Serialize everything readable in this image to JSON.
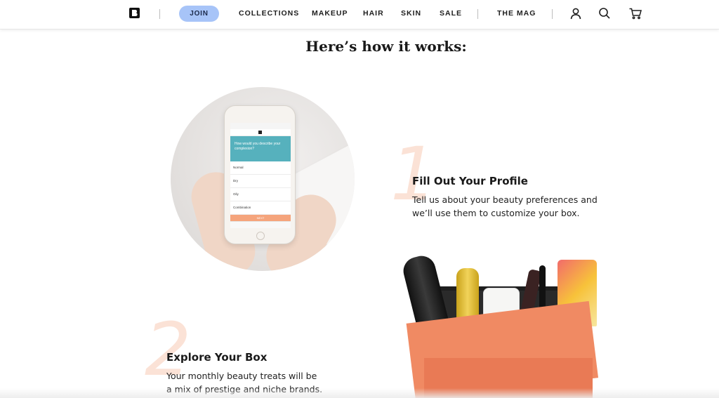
{
  "nav": {
    "join_label": "JOIN",
    "links": [
      "COLLECTIONS",
      "MAKEUP",
      "HAIR",
      "SKIN",
      "SALE",
      "THE MAG"
    ],
    "icons": [
      "account-icon",
      "search-icon",
      "cart-icon"
    ],
    "join_color": "#a7c4f8"
  },
  "main": {
    "headline": "Here’s how it works:",
    "steps": [
      {
        "number": "1",
        "title": "Fill Out Your Profile",
        "description_line1": "Tell us about your beauty preferences and",
        "description_line2": "we’ll use them to customize your box."
      },
      {
        "number": "2",
        "title": "Explore Your Box",
        "description_line1": "Your monthly beauty treats will be",
        "description_line2": "a mix of prestige and niche brands."
      }
    ]
  },
  "phone_screen": {
    "question": "How would you describe your complexion?",
    "options": [
      "Normal",
      "Dry",
      "Oily",
      "Combination"
    ],
    "next_label": "NEXT"
  },
  "colors": {
    "accent_peach": "#fbe2d6",
    "box_orange": "#f08a63",
    "screen_teal": "#56b1bd"
  }
}
